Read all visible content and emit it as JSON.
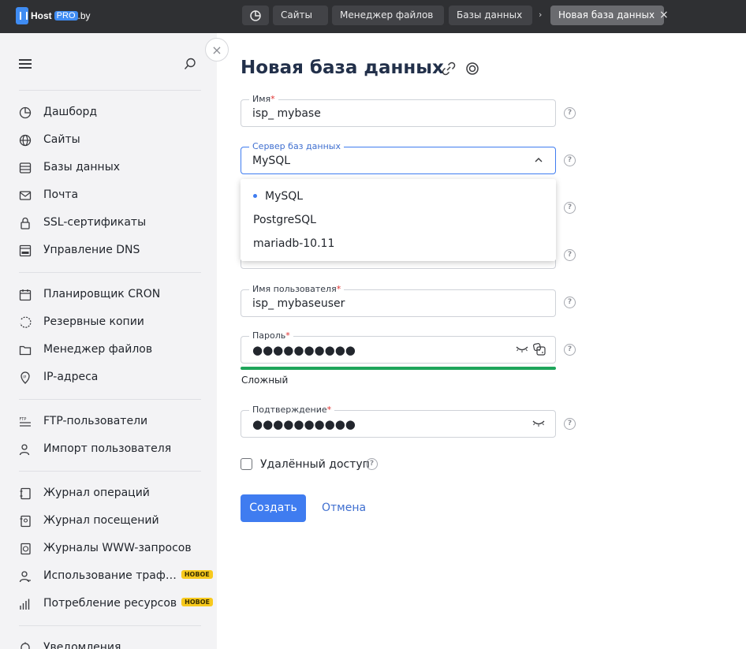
{
  "topbar": {
    "logo_text": "Host",
    "logo_pro": "PRO",
    "logo_domain": ".by",
    "breadcrumbs": [
      "Сайты",
      "Менеджер файлов",
      "Базы данных"
    ],
    "active_tab": "Новая база данных"
  },
  "sidebar": {
    "items": [
      {
        "label": "Дашборд",
        "icon": "dashboard-icon"
      },
      {
        "label": "Сайты",
        "icon": "globe-icon"
      },
      {
        "label": "Базы данных",
        "icon": "database-icon"
      },
      {
        "label": "Почта",
        "icon": "mail-icon"
      },
      {
        "label": "SSL-сертификаты",
        "icon": "lock-icon"
      },
      {
        "label": "Управление DNS",
        "icon": "dns-icon"
      },
      {
        "label": "Планировщик CRON",
        "icon": "calendar-icon"
      },
      {
        "label": "Резервные копии",
        "icon": "backup-icon"
      },
      {
        "label": "Менеджер файлов",
        "icon": "folder-icon"
      },
      {
        "label": "IP-адреса",
        "icon": "ip-icon"
      },
      {
        "label": "FTP-пользователи",
        "icon": "ftp-icon"
      },
      {
        "label": "Импорт пользователя",
        "icon": "user-import-icon"
      },
      {
        "label": "Журнал операций",
        "icon": "operations-log-icon"
      },
      {
        "label": "Журнал посещений",
        "icon": "visits-log-icon"
      },
      {
        "label": "Журналы WWW-запросов",
        "icon": "www-log-icon"
      },
      {
        "label": "Использование траф…",
        "icon": "traffic-icon",
        "badge": "НОВОЕ"
      },
      {
        "label": "Потребление ресурсов",
        "icon": "resources-icon",
        "badge": "НОВОЕ"
      },
      {
        "label": "Уведомления",
        "icon": "bell-icon"
      }
    ]
  },
  "main": {
    "title": "Новая база данных",
    "name_field": {
      "label": "Имя",
      "value": "isp_  mybase"
    },
    "server_field": {
      "label": "Сервер баз данных",
      "value": "MySQL"
    },
    "server_options": [
      "MySQL",
      "PostgreSQL",
      "mariadb-10.11"
    ],
    "user_field": {
      "label": "Имя пользователя",
      "value": "isp_  mybaseuser"
    },
    "password_field": {
      "label": "Пароль",
      "value": "●●●●●●●●●●"
    },
    "password_strength": "Сложный",
    "password_strength_fraction": 1.0,
    "confirm_field": {
      "label": "Подтверждение",
      "value": "●●●●●●●●●●"
    },
    "remote_access_label": "Удалённый доступ",
    "remote_access_checked": false,
    "create_button": "Создать",
    "cancel_button": "Отмена"
  },
  "colors": {
    "accent": "#3f7cf0",
    "topbar": "#2f3033",
    "sidebar": "#f3f3f5",
    "strength": "#1ea55a",
    "badge": "#f7c91d",
    "required": "#e0302f"
  }
}
